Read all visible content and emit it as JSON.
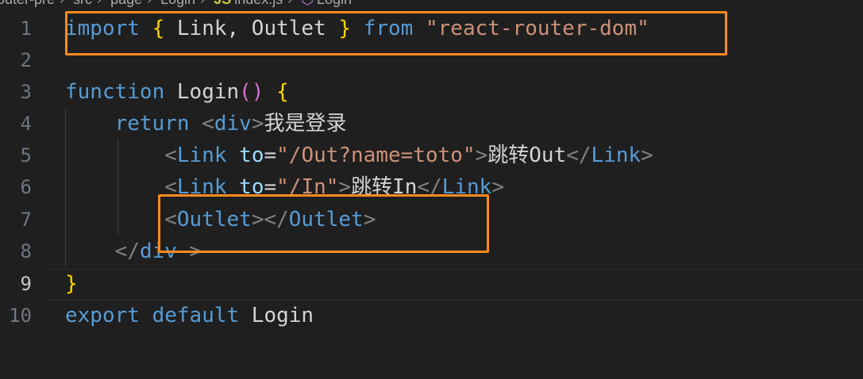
{
  "breadcrumb": {
    "items": [
      "ct-router-pre",
      "src",
      "page",
      "Login"
    ],
    "file": "index.js",
    "file_icon": "JS",
    "symbol": "Login",
    "symbol_icon": "symbol-method-icon"
  },
  "editor": {
    "active_line": 9,
    "lines": [
      {
        "no": "1",
        "tokens": [
          {
            "t": "import",
            "c": "kw"
          },
          {
            "t": " ",
            "c": "plain"
          },
          {
            "t": "{",
            "c": "br"
          },
          {
            "t": " Link, Outlet ",
            "c": "plain"
          },
          {
            "t": "}",
            "c": "br"
          },
          {
            "t": " ",
            "c": "plain"
          },
          {
            "t": "from",
            "c": "kw"
          },
          {
            "t": " ",
            "c": "plain"
          },
          {
            "t": "\"react-router-dom\"",
            "c": "str"
          }
        ]
      },
      {
        "no": "2",
        "tokens": []
      },
      {
        "no": "3",
        "tokens": [
          {
            "t": "function",
            "c": "kw"
          },
          {
            "t": " Login",
            "c": "plain"
          },
          {
            "t": "()",
            "c": "br2"
          },
          {
            "t": " ",
            "c": "plain"
          },
          {
            "t": "{",
            "c": "br"
          }
        ]
      },
      {
        "no": "4",
        "tokens": [
          {
            "t": "    ",
            "c": "plain"
          },
          {
            "t": "return",
            "c": "kw"
          },
          {
            "t": " ",
            "c": "plain"
          },
          {
            "t": "<",
            "c": "angle"
          },
          {
            "t": "div",
            "c": "tag"
          },
          {
            "t": ">",
            "c": "angle"
          },
          {
            "t": "我是登录",
            "c": "plain cjk"
          }
        ]
      },
      {
        "no": "5",
        "tokens": [
          {
            "t": "        ",
            "c": "plain"
          },
          {
            "t": "<",
            "c": "angle"
          },
          {
            "t": "Link",
            "c": "tag"
          },
          {
            "t": " ",
            "c": "plain"
          },
          {
            "t": "to",
            "c": "attr"
          },
          {
            "t": "=",
            "c": "plain"
          },
          {
            "t": "\"/Out?name=toto\"",
            "c": "str"
          },
          {
            "t": ">",
            "c": "angle"
          },
          {
            "t": "跳转",
            "c": "plain cjk"
          },
          {
            "t": "Out",
            "c": "plain"
          },
          {
            "t": "</",
            "c": "angle"
          },
          {
            "t": "Link",
            "c": "tag"
          },
          {
            "t": ">",
            "c": "angle"
          }
        ]
      },
      {
        "no": "6",
        "tokens": [
          {
            "t": "        ",
            "c": "plain"
          },
          {
            "t": "<",
            "c": "angle"
          },
          {
            "t": "Link",
            "c": "tag"
          },
          {
            "t": " ",
            "c": "plain"
          },
          {
            "t": "to",
            "c": "attr"
          },
          {
            "t": "=",
            "c": "plain"
          },
          {
            "t": "\"/In\"",
            "c": "str"
          },
          {
            "t": ">",
            "c": "angle"
          },
          {
            "t": "跳转",
            "c": "plain cjk"
          },
          {
            "t": "In",
            "c": "plain"
          },
          {
            "t": "</",
            "c": "angle"
          },
          {
            "t": "Link",
            "c": "tag"
          },
          {
            "t": ">",
            "c": "angle"
          }
        ]
      },
      {
        "no": "7",
        "tokens": [
          {
            "t": "        ",
            "c": "plain"
          },
          {
            "t": "<",
            "c": "angle"
          },
          {
            "t": "Outlet",
            "c": "tag"
          },
          {
            "t": "></",
            "c": "angle"
          },
          {
            "t": "Outlet",
            "c": "tag"
          },
          {
            "t": ">",
            "c": "angle"
          }
        ]
      },
      {
        "no": "8",
        "tokens": [
          {
            "t": "    ",
            "c": "plain"
          },
          {
            "t": "</",
            "c": "angle"
          },
          {
            "t": "div",
            "c": "tag"
          },
          {
            "t": " >",
            "c": "angle"
          }
        ]
      },
      {
        "no": "9",
        "tokens": [
          {
            "t": "}",
            "c": "br"
          }
        ]
      },
      {
        "no": "10",
        "tokens": [
          {
            "t": "export",
            "c": "kw"
          },
          {
            "t": " ",
            "c": "plain"
          },
          {
            "t": "default",
            "c": "kw"
          },
          {
            "t": " Login",
            "c": "plain"
          }
        ]
      }
    ]
  },
  "annotations": {
    "color": "#ff8a1f",
    "boxes": [
      "import-line-highlight",
      "outlet-line-highlight"
    ]
  }
}
